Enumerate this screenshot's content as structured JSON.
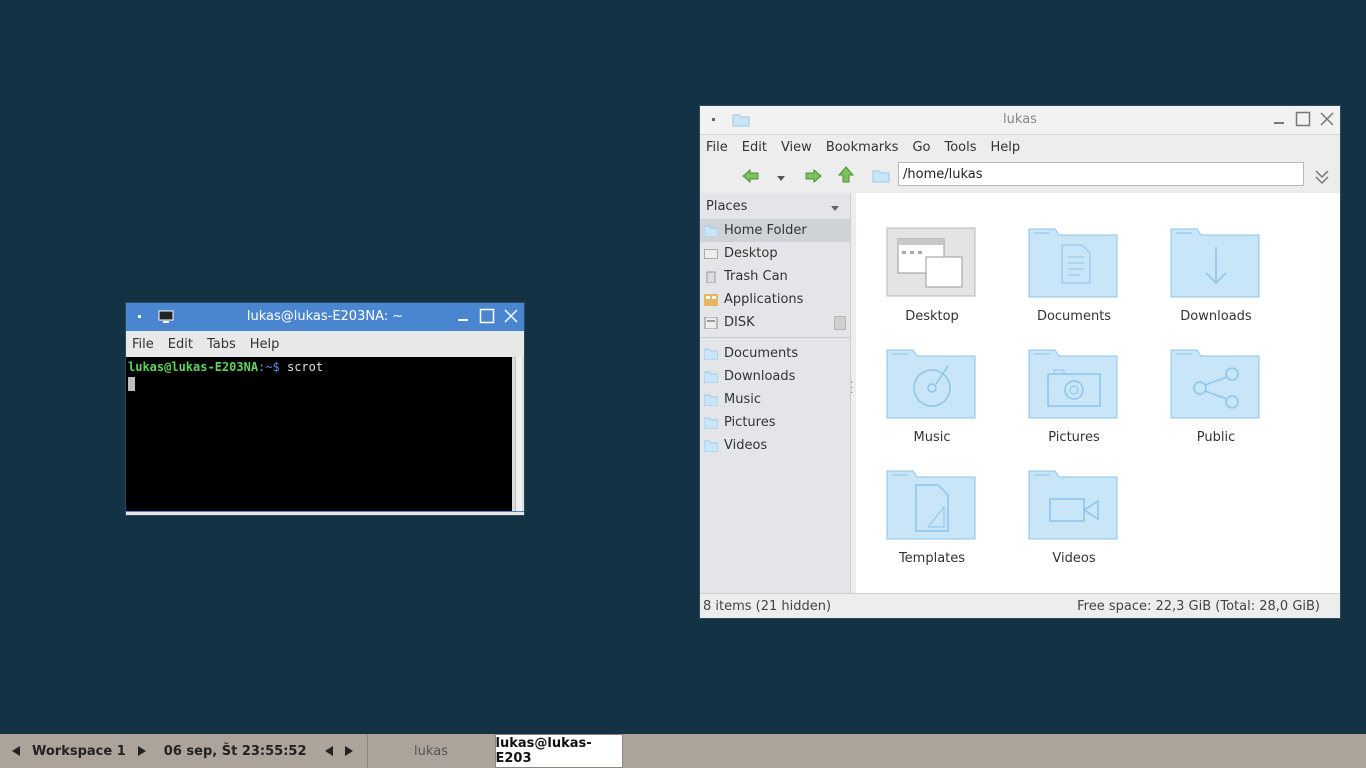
{
  "colors": {
    "desktop_bg": "#133243",
    "terminal_title_bg": "#4a86cf",
    "terminal_user": "#5ed35e",
    "terminal_path": "#5c8fd6",
    "folder_blue": "#c9e6f8",
    "taskbar_bg": "#aca39a"
  },
  "terminal": {
    "title": "lukas@lukas-E203NA: ~",
    "menu": [
      "File",
      "Edit",
      "Tabs",
      "Help"
    ],
    "prompt_user": "lukas@lukas-E203NA",
    "prompt_path": ":~$",
    "command": "scrot"
  },
  "file_manager": {
    "title": "lukas",
    "menu": [
      "File",
      "Edit",
      "View",
      "Bookmarks",
      "Go",
      "Tools",
      "Help"
    ],
    "path": "/home/lukas",
    "places_label": "Places",
    "places": [
      {
        "label": "Home Folder",
        "icon": "home-folder-icon",
        "selected": true
      },
      {
        "label": "Desktop",
        "icon": "desktop-icon"
      },
      {
        "label": "Trash Can",
        "icon": "trash-icon"
      },
      {
        "label": "Applications",
        "icon": "applications-icon"
      },
      {
        "label": "DISK",
        "icon": "disk-icon"
      }
    ],
    "bookmarks": [
      {
        "label": "Documents",
        "icon": "folder-icon"
      },
      {
        "label": "Downloads",
        "icon": "folder-icon"
      },
      {
        "label": "Music",
        "icon": "folder-icon"
      },
      {
        "label": "Pictures",
        "icon": "folder-icon"
      },
      {
        "label": "Videos",
        "icon": "folder-icon"
      }
    ],
    "items": [
      {
        "label": "Desktop",
        "icon": "desktop-folder-icon"
      },
      {
        "label": "Documents",
        "icon": "documents-folder-icon"
      },
      {
        "label": "Downloads",
        "icon": "downloads-folder-icon"
      },
      {
        "label": "Music",
        "icon": "music-folder-icon"
      },
      {
        "label": "Pictures",
        "icon": "pictures-folder-icon"
      },
      {
        "label": "Public",
        "icon": "public-folder-icon"
      },
      {
        "label": "Templates",
        "icon": "templates-folder-icon"
      },
      {
        "label": "Videos",
        "icon": "videos-folder-icon"
      }
    ],
    "status_left": "8 items (21 hidden)",
    "status_right": "Free space: 22,3 GiB (Total: 28,0 GiB)"
  },
  "taskbar": {
    "workspace": "Workspace 1",
    "clock": "06 sep, Št 23:55:52",
    "tasks": [
      {
        "label": "lukas",
        "active": false
      },
      {
        "label": "lukas@lukas-E203",
        "active": true
      }
    ]
  }
}
